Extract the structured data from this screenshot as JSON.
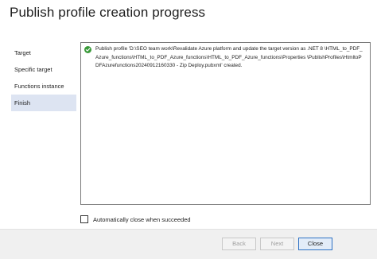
{
  "dialog": {
    "title": "Publish profile creation progress"
  },
  "steps": [
    {
      "label": "Target",
      "active": false
    },
    {
      "label": "Specific target",
      "active": false
    },
    {
      "label": "Functions instance",
      "active": false
    },
    {
      "label": "Finish",
      "active": true
    }
  ],
  "log": {
    "status_icon": "success-check-icon",
    "status_color": "#3a9a3a",
    "message": "Publish profile 'D:\\SEO team work\\Revalidate Azure platform and update the target version as .NET 8 \\HTML_to_PDF_Azure_functions\\HTML_to_PDF_Azure_functions\\HTML_to_PDF_Azure_functions\\Properties \\PublishProfiles\\HtmltoPDFAzurefunctions20240912160330 - Zip Deploy.pubxml' created."
  },
  "options": {
    "auto_close_label": "Automatically close when succeeded",
    "auto_close_checked": false
  },
  "buttons": {
    "back": "Back",
    "next": "Next",
    "close": "Close"
  },
  "colors": {
    "accent": "#2f72c4",
    "active_step_bg": "#dde4f2"
  }
}
